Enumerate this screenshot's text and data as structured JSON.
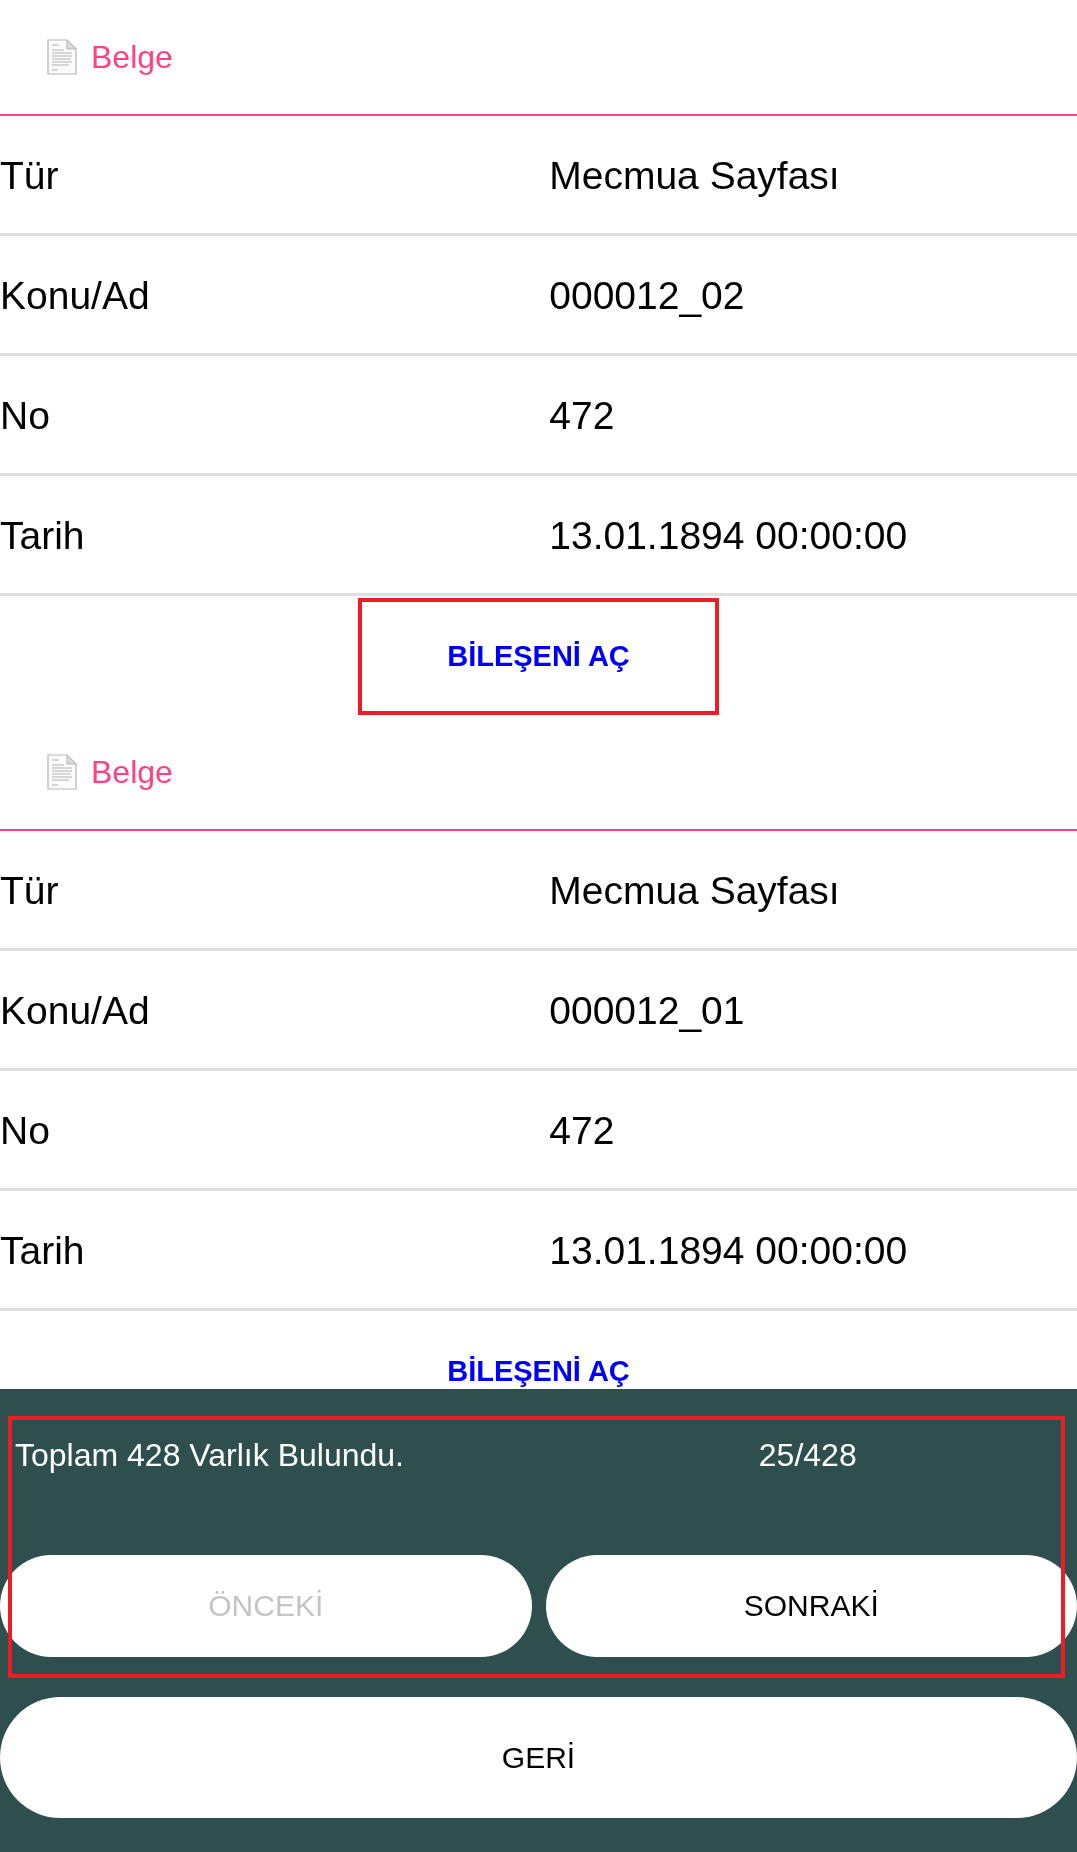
{
  "records": [
    {
      "header": {
        "label": "Belge"
      },
      "fields": [
        {
          "label": "Tür",
          "value": "Mecmua Sayfası"
        },
        {
          "label": "Konu/Ad",
          "value": "000012_02"
        },
        {
          "label": "No",
          "value": "472"
        },
        {
          "label": "Tarih",
          "value": "13.01.1894 00:00:00"
        }
      ],
      "open_button": {
        "label": "BİLEŞENİ AÇ",
        "highlighted": true
      }
    },
    {
      "header": {
        "label": "Belge"
      },
      "fields": [
        {
          "label": "Tür",
          "value": "Mecmua Sayfası"
        },
        {
          "label": "Konu/Ad",
          "value": "000012_01"
        },
        {
          "label": "No",
          "value": "472"
        },
        {
          "label": "Tarih",
          "value": "13.01.1894 00:00:00"
        }
      ],
      "open_button": {
        "label": "BİLEŞENİ AÇ",
        "highlighted": false
      }
    }
  ],
  "footer": {
    "pager": {
      "summary": "Toplam 428 Varlık Bulundu.",
      "count": "25/428",
      "highlighted": true,
      "buttons": [
        {
          "label": "ÖNCEKİ",
          "disabled": true
        },
        {
          "label": "SONRAKİ",
          "disabled": false
        }
      ]
    },
    "back_button": {
      "label": "GERİ"
    }
  }
}
